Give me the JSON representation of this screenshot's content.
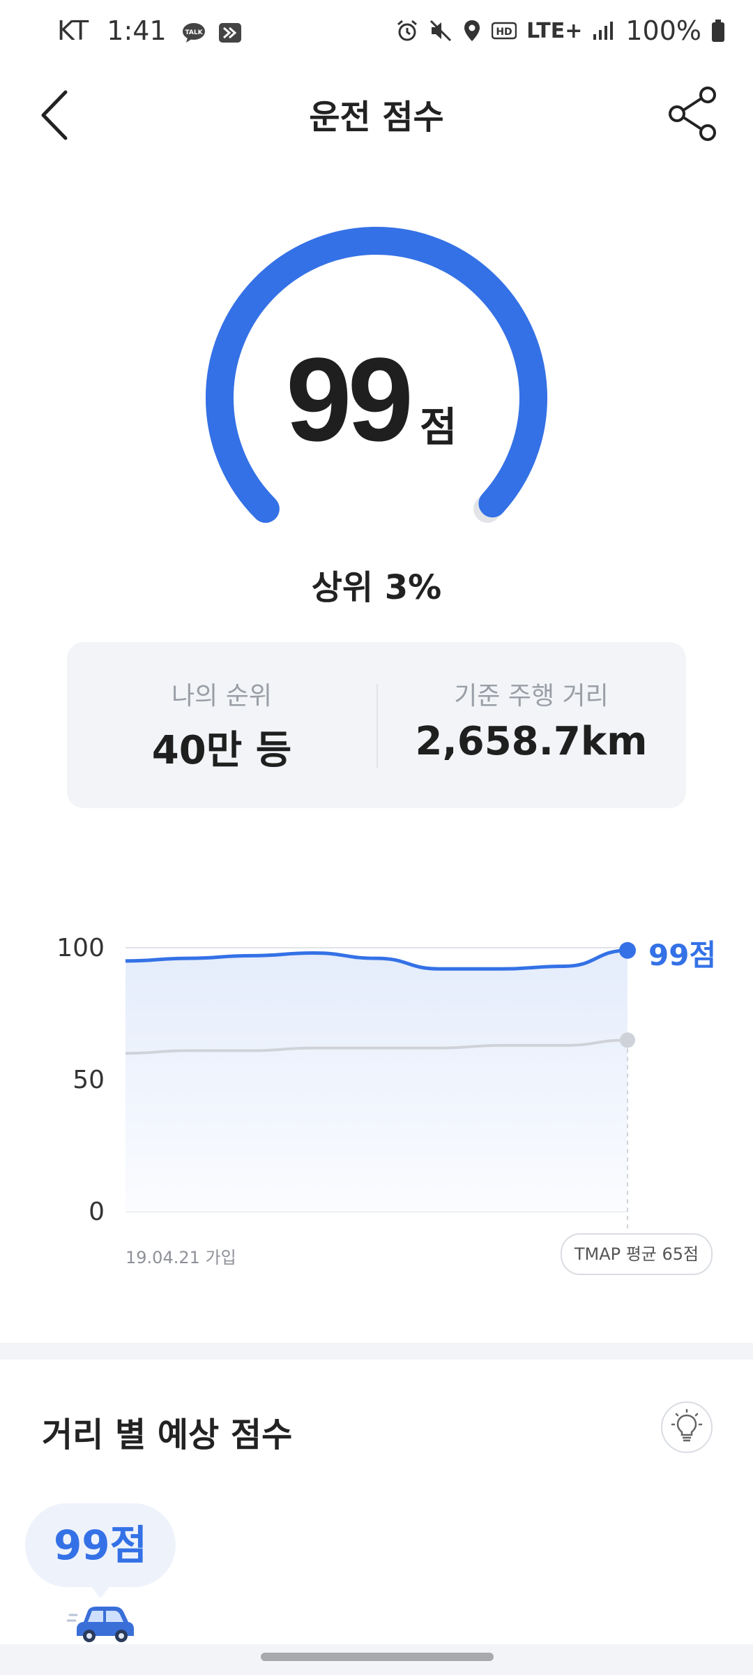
{
  "status_bar": {
    "carrier": "KT",
    "time": "1:41",
    "network": "LTE+",
    "battery": "100%"
  },
  "header": {
    "title": "운전 점수"
  },
  "score": {
    "value": "99",
    "unit": "점",
    "gauge_level": 0.99,
    "rank_text": "상위 3%"
  },
  "info_card": {
    "rank_label": "나의 순위",
    "rank_value": "40만 등",
    "distance_label": "기준 주행 거리",
    "distance_value": "2,658.7km"
  },
  "chart_data": {
    "type": "line",
    "ylim": [
      0,
      100
    ],
    "y_ticks": [
      "100",
      "50",
      "0"
    ],
    "x_start_label": "19.04.21 가입",
    "series": [
      {
        "name": "",
        "color": "#3471e6",
        "values": [
          95,
          96,
          97,
          98,
          96,
          92,
          92,
          93,
          99
        ]
      },
      {
        "name": "TMAP 평균 65점",
        "color": "#cfd3d9",
        "values": [
          60,
          61,
          61,
          62,
          62,
          62,
          63,
          63,
          65
        ]
      }
    ],
    "end_label": "99점",
    "average_label": "TMAP 평균 65점"
  },
  "expected_section": {
    "title": "거리 별 예상 점수",
    "bubble_score": "99점"
  },
  "colors": {
    "accent": "#3471e6",
    "gauge_track": "#e2e4e8",
    "card_bg": "#f2f4f7"
  },
  "icons": [
    "back-arrow-icon",
    "share-icon",
    "lightbulb-icon",
    "car-icon"
  ]
}
